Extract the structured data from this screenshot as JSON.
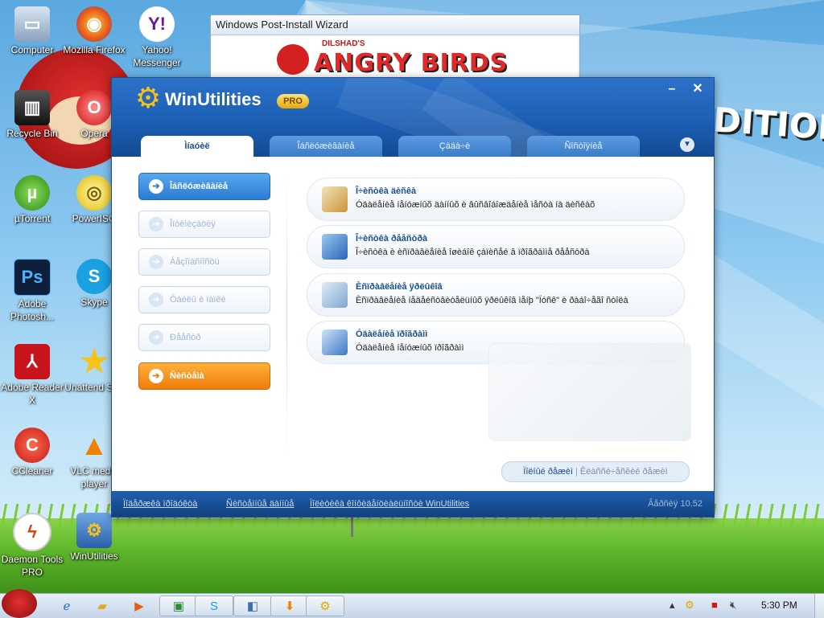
{
  "colors": {
    "brand_blue": "#1c5fb5",
    "accent_orange": "#f07c0a",
    "accent_blue": "#2b7bd4",
    "card_title": "#1b4f8c"
  },
  "desktop": {
    "background_text": "DITION",
    "icons": [
      {
        "name": "computer",
        "label": "Computer",
        "icon": "computer-icon"
      },
      {
        "name": "firefox",
        "label": "Mozilla Firefox",
        "icon": "firefox-icon"
      },
      {
        "name": "yahoo",
        "label": "Yahoo! Messenger",
        "icon": "yahoo-messenger-icon"
      },
      {
        "name": "recycle",
        "label": "Recycle Bin",
        "icon": "recycle-bin-icon"
      },
      {
        "name": "opera",
        "label": "Opera",
        "icon": "opera-icon"
      },
      {
        "name": "utorrent",
        "label": "µTorrent",
        "icon": "utorrent-icon"
      },
      {
        "name": "poweriso",
        "label": "PowerISO",
        "icon": "poweriso-icon"
      },
      {
        "name": "photoshop",
        "label": "Adobe Photosh...",
        "icon": "photoshop-icon"
      },
      {
        "name": "skype",
        "label": "Skype",
        "icon": "skype-icon"
      },
      {
        "name": "adobe-reader",
        "label": "Adobe Reader X",
        "icon": "adobe-reader-icon"
      },
      {
        "name": "unattend",
        "label": "Unattend Soft",
        "icon": "unattend-icon"
      },
      {
        "name": "ccleaner",
        "label": "CCleaner",
        "icon": "ccleaner-icon"
      },
      {
        "name": "vlc",
        "label": "VLC media player",
        "icon": "vlc-icon"
      },
      {
        "name": "daemon",
        "label": "Daemon Tools PRO",
        "icon": "daemon-tools-icon"
      },
      {
        "name": "winutilities",
        "label": "WinUtilities",
        "icon": "winutilities-icon"
      }
    ]
  },
  "wizard": {
    "title": "Windows Post-Install Wizard",
    "banner_sub": "DILSHAD'S",
    "banner_text": "ANGRY BIRDS EDITION"
  },
  "app": {
    "title": "WinUtilities",
    "badge": "PRO",
    "tabs": [
      {
        "label": "Ìíaóèë",
        "active": true
      },
      {
        "label": "Îáñëóæèâàíèå",
        "active": false
      },
      {
        "label": "Çàäà÷è",
        "active": false
      },
      {
        "label": "Ñîñòîÿíèå",
        "active": false
      }
    ],
    "menu": [
      {
        "label": "Îáñëóæèâàíèå",
        "style": "blue"
      },
      {
        "label": "Îïòèìèçàöèÿ",
        "style": "plain"
      },
      {
        "label": "Áåçîïàñíîñòü",
        "style": "plain"
      },
      {
        "label": "Ôàéëû è ïàïêè",
        "style": "plain"
      },
      {
        "label": "Ðååñòð",
        "style": "plain"
      },
      {
        "label": "Ñèñòåìà",
        "style": "orange"
      }
    ],
    "cards": [
      {
        "title": "Î÷èñòêà äèñêà",
        "desc": "Óäàëåíèå íåíóæíûõ äàííûõ è âûñâîáîæäåíèå ìåñòà íà äèñêàõ",
        "icon": "disk-cleanup-icon"
      },
      {
        "title": "Î÷èñòêà ðååñòðà",
        "desc": "Î÷èñòêà è èñïðàâëåíèå îøèáîê çàïèñåé â ïðîãðàììå ðååñòðà",
        "icon": "registry-cleanup-icon"
      },
      {
        "title": "Èñïðàâëåíèå ÿðëûêîâ",
        "desc": "Èñïðàâëåíèå íåäåéñòâèòåëüíûõ ÿðëûêîâ ìåíþ \"Ïóñê\" è ðàáî÷åãî ñòîëà",
        "icon": "shortcut-fix-icon"
      },
      {
        "title": "Óäàëåíèå ïðîãðàìì",
        "desc": "Óäàëåíèå íåíóæíûõ ïðîãðàìì",
        "icon": "uninstall-icon"
      }
    ],
    "status": {
      "left": "Ïîëíûé ðåæèì",
      "sep": "|",
      "right": "Êëàññè÷åñêèé ðåæèì"
    },
    "footer": {
      "link1": "Ïîäåðæêà ïðîäóêòà",
      "link2": "Ñèñòåìíûå äàííûå",
      "link3": "Ïîëèòèêà êîíôèäåíöèàëüíîñòè WinUtilities",
      "version": "Âåðñèÿ 10.52"
    }
  },
  "taskbar": {
    "buttons": [
      {
        "name": "ie",
        "icon": "internet-explorer-icon"
      },
      {
        "name": "explorer",
        "icon": "folder-icon"
      },
      {
        "name": "media",
        "icon": "media-player-icon"
      },
      {
        "name": "task1",
        "icon": "screenshot-app-icon"
      },
      {
        "name": "task2",
        "icon": "skype-task-icon"
      },
      {
        "name": "task3",
        "icon": "wizard-task-icon"
      },
      {
        "name": "task4",
        "icon": "download-task-icon"
      },
      {
        "name": "task5",
        "icon": "winutilities-task-icon"
      }
    ],
    "clock": "5:30 PM"
  }
}
